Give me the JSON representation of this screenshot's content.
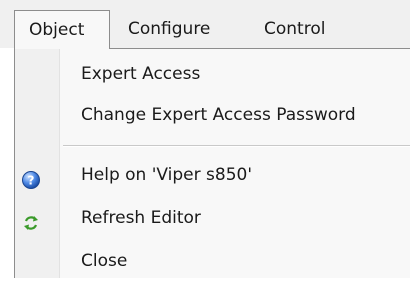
{
  "menubar": {
    "items": [
      {
        "label": "Object"
      },
      {
        "label": "Configure"
      },
      {
        "label": "Control"
      }
    ]
  },
  "dropdown": {
    "items": [
      {
        "label": "Expert Access",
        "icon": null
      },
      {
        "label": "Change Expert Access Password",
        "icon": null
      },
      {
        "label": "Help on 'Viper  s850'",
        "icon": "help-icon"
      },
      {
        "label": "Refresh Editor",
        "icon": "refresh-icon"
      },
      {
        "label": "Close",
        "icon": null
      }
    ]
  },
  "colors": {
    "help_icon": "#2f6fd6",
    "refresh_icon": "#3a9a2a"
  }
}
